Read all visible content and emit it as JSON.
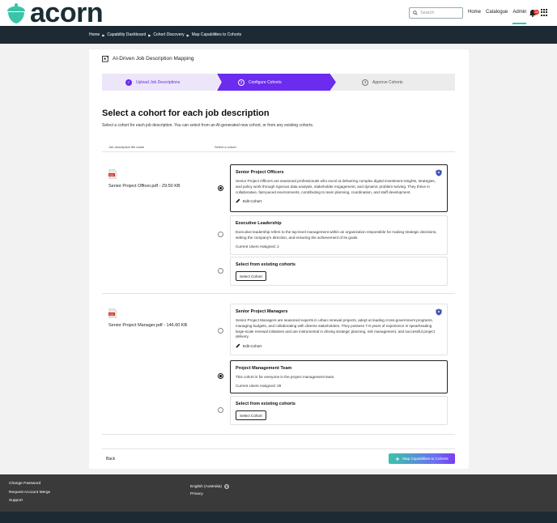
{
  "header": {
    "logo_text": "acorn",
    "search_placeholder": "Search",
    "nav": [
      "Home",
      "Catalogue",
      "Admin"
    ],
    "notification_count": "30"
  },
  "breadcrumb": [
    "Home",
    "Capability Dashboard",
    "Cohort Discovery",
    "Map Capabilities to Cohorts"
  ],
  "page": {
    "card_title": "AI-Driven Job Description Mapping",
    "steps": [
      {
        "number": "1",
        "label": "Upload Job Descriptions",
        "state": "done"
      },
      {
        "number": "2",
        "label": "Configure Cohorts",
        "state": "active"
      },
      {
        "number": "3",
        "label": "Approve Cohorts",
        "state": "pending"
      }
    ],
    "heading": "Select a cohort for each job description",
    "subheading": "Select a cohort for each job description. You can select from an AI-generated new cohort, or from any existing cohorts.",
    "col_file": "Job description file name",
    "col_cohort": "Select a cohort"
  },
  "jobs": [
    {
      "file": "Senior Project Officer.pdf - 29.50 KB",
      "options": [
        {
          "title": "Senior Project Officers",
          "desc": "Senior Project Officers are seasoned professionals who excel at delivering complex digital investment insights, strategies, and policy work through rigorous data analysis, stakeholder engagement, and dynamic problem-solving. They thrive in collaborative, fast-paced environments, contributing to team planning, coordination, and staff development.",
          "action": "Edit Cohort"
        },
        {
          "title": "Executive Leadership",
          "desc": "Executive leadership refers to the top-level management within an organization responsible for making strategic decisions, setting the company's direction, and ensuring the achievement of its goals.",
          "meta": "Current Users Assigned: 2"
        },
        {
          "title": "Select from existing cohorts",
          "action": "Select Cohort"
        }
      ]
    },
    {
      "file": "Senior Project Manager.pdf - 146.60 KB",
      "options": [
        {
          "title": "Senior Project Managers",
          "desc": "Senior Project Managers are seasoned experts in urban renewal projects, adept at leading cross-government programs, managing budgets, and collaborating with diverse stakeholders. They possess 7-8 years of experience in spearheading large-scale renewal initiatives and are instrumental in driving strategic planning, risk management, and successful project delivery.",
          "action": "Edit Cohort"
        },
        {
          "title": "Project Management Team",
          "desc": "This cohort is for everyone in the project management team.",
          "meta": "Current Users Assigned: 29"
        },
        {
          "title": "Select from existing cohorts",
          "action": "Select Cohort"
        }
      ]
    }
  ],
  "actions": {
    "back": "Back",
    "submit": "Map Capabilities to Cohorts"
  },
  "footer": {
    "links": [
      "Change Password",
      "Request Account Merge",
      "Support"
    ],
    "language": "English (Australia)",
    "privacy": "Privacy"
  },
  "colors": {
    "brand_dark": "#1d2a33",
    "accent_purple": "#6b2cef",
    "accent_teal": "#3ac4a8",
    "logo_green": "#3ac4a8"
  }
}
